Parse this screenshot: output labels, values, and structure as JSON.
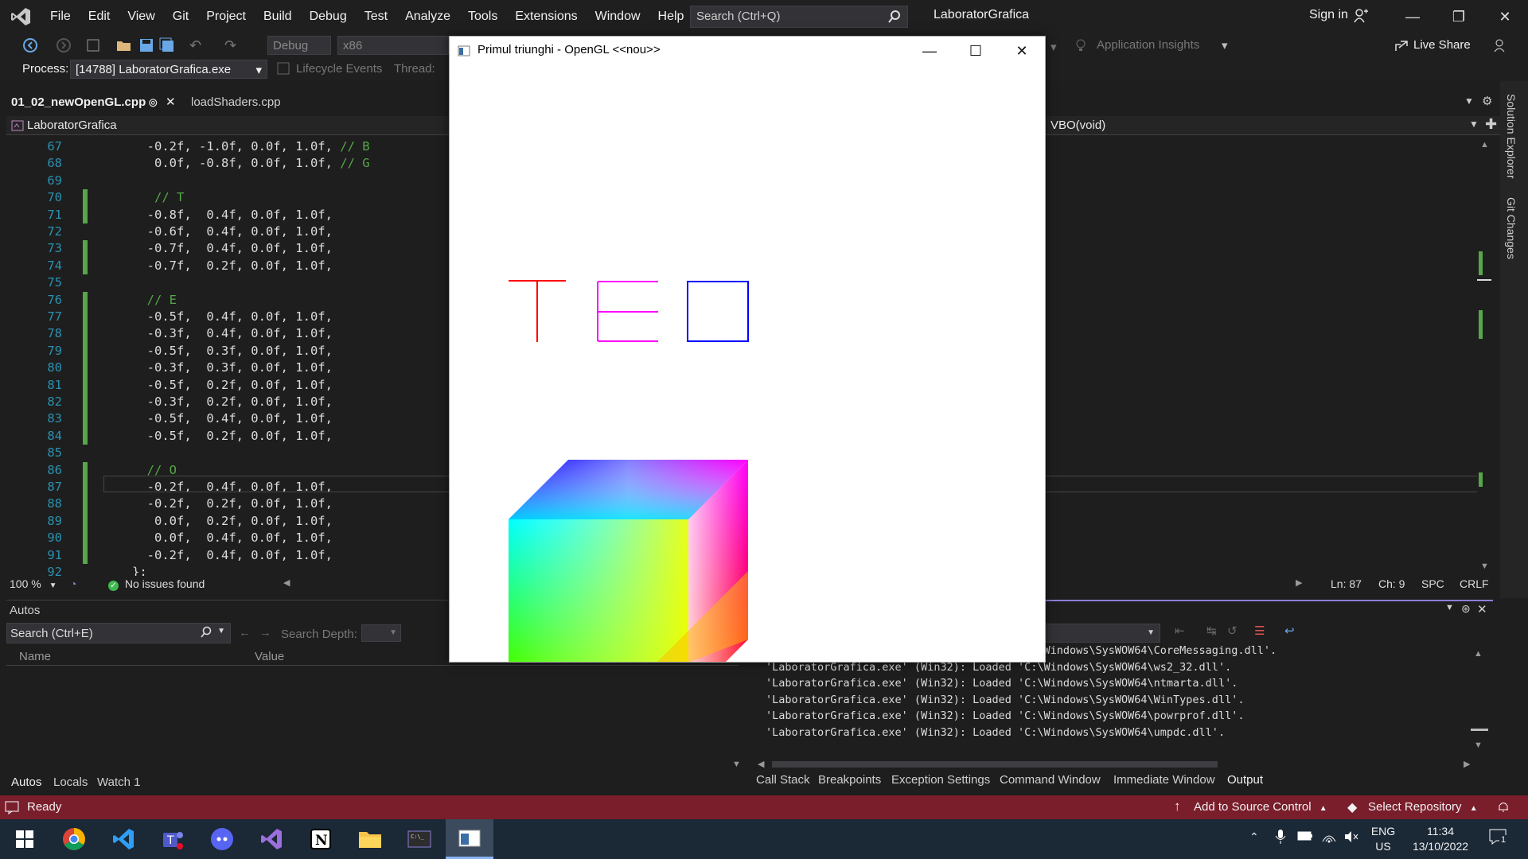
{
  "menubar": {
    "items": [
      "File",
      "Edit",
      "View",
      "Git",
      "Project",
      "Build",
      "Debug",
      "Test",
      "Analyze",
      "Tools",
      "Extensions",
      "Window",
      "Help"
    ],
    "search_placeholder": "Search (Ctrl+Q)",
    "solution_name": "LaboratorGrafica",
    "sign_in": "Sign in"
  },
  "toolbar": {
    "config": "Debug",
    "platform": "x86",
    "app_insights": "Application Insights",
    "live_share": "Live Share",
    "process_label": "Process:",
    "process_value": "[14788] LaboratorGrafica.exe",
    "lifecycle": "Lifecycle Events",
    "thread_label": "Thread:"
  },
  "editor": {
    "tabs": [
      "01_02_newOpenGL.cpp",
      "loadShaders.cpp"
    ],
    "project_nav": "LaboratorGrafica",
    "member_nav": "VBO(void)",
    "lines": [
      {
        "n": "67",
        "code": "  -0.2f, -1.0f, 0.0f, 1.0f, ",
        "comment": "// B",
        "changed": false
      },
      {
        "n": "68",
        "code": "   0.0f, -0.8f, 0.0f, 1.0f, ",
        "comment": "// G",
        "changed": false
      },
      {
        "n": "69",
        "code": "",
        "comment": "",
        "changed": false
      },
      {
        "n": "70",
        "code": "   ",
        "comment": "// T",
        "changed": true
      },
      {
        "n": "71",
        "code": "  -0.8f,  0.4f, 0.0f, 1.0f,",
        "comment": "",
        "changed": true
      },
      {
        "n": "72",
        "code": "  -0.6f,  0.4f, 0.0f, 1.0f,",
        "comment": "",
        "changed": false
      },
      {
        "n": "73",
        "code": "  -0.7f,  0.4f, 0.0f, 1.0f,",
        "comment": "",
        "changed": true
      },
      {
        "n": "74",
        "code": "  -0.7f,  0.2f, 0.0f, 1.0f,",
        "comment": "",
        "changed": true
      },
      {
        "n": "75",
        "code": "",
        "comment": "",
        "changed": false
      },
      {
        "n": "76",
        "code": "  ",
        "comment": "// E",
        "changed": true
      },
      {
        "n": "77",
        "code": "  -0.5f,  0.4f, 0.0f, 1.0f,",
        "comment": "",
        "changed": true
      },
      {
        "n": "78",
        "code": "  -0.3f,  0.4f, 0.0f, 1.0f,",
        "comment": "",
        "changed": true
      },
      {
        "n": "79",
        "code": "  -0.5f,  0.3f, 0.0f, 1.0f,",
        "comment": "",
        "changed": true
      },
      {
        "n": "80",
        "code": "  -0.3f,  0.3f, 0.0f, 1.0f,",
        "comment": "",
        "changed": true
      },
      {
        "n": "81",
        "code": "  -0.5f,  0.2f, 0.0f, 1.0f,",
        "comment": "",
        "changed": true
      },
      {
        "n": "82",
        "code": "  -0.3f,  0.2f, 0.0f, 1.0f,",
        "comment": "",
        "changed": true
      },
      {
        "n": "83",
        "code": "  -0.5f,  0.4f, 0.0f, 1.0f,",
        "comment": "",
        "changed": true
      },
      {
        "n": "84",
        "code": "  -0.5f,  0.2f, 0.0f, 1.0f,",
        "comment": "",
        "changed": true
      },
      {
        "n": "85",
        "code": "",
        "comment": "",
        "changed": false
      },
      {
        "n": "86",
        "code": "  ",
        "comment": "// O",
        "changed": true
      },
      {
        "n": "87",
        "code": "  -0.2f,  0.4f, 0.0f, 1.0f,",
        "comment": "",
        "changed": true
      },
      {
        "n": "88",
        "code": "  -0.2f,  0.2f, 0.0f, 1.0f,",
        "comment": "",
        "changed": true
      },
      {
        "n": "89",
        "code": "   0.0f,  0.2f, 0.0f, 1.0f,",
        "comment": "",
        "changed": true
      },
      {
        "n": "90",
        "code": "   0.0f,  0.4f, 0.0f, 1.0f,",
        "comment": "",
        "changed": true
      },
      {
        "n": "91",
        "code": "  -0.2f,  0.4f, 0.0f, 1.0f,",
        "comment": "",
        "changed": true
      },
      {
        "n": "92",
        "code": "};",
        "comment": "",
        "changed": false
      }
    ],
    "zoom": "100 %",
    "issues": "No issues found",
    "ln": "Ln: 87",
    "ch": "Ch: 9",
    "spc": "SPC",
    "crlf": "CRLF"
  },
  "side_tabs": [
    "Solution Explorer",
    "Git Changes"
  ],
  "autos": {
    "title": "Autos",
    "search_placeholder": "Search (Ctrl+E)",
    "search_depth": "Search Depth:",
    "col_name": "Name",
    "col_value": "Value",
    "tabs": [
      "Autos",
      "Locals",
      "Watch 1"
    ]
  },
  "output": {
    "lines": [
      "'LaboratorGrafica.exe' (Win32): Loaded 'C:\\Windows\\SysWOW64\\CoreMessaging.dll'.",
      "'LaboratorGrafica.exe' (Win32): Loaded 'C:\\Windows\\SysWOW64\\ws2_32.dll'.",
      "'LaboratorGrafica.exe' (Win32): Loaded 'C:\\Windows\\SysWOW64\\ntmarta.dll'.",
      "'LaboratorGrafica.exe' (Win32): Loaded 'C:\\Windows\\SysWOW64\\WinTypes.dll'.",
      "'LaboratorGrafica.exe' (Win32): Loaded 'C:\\Windows\\SysWOW64\\powrprof.dll'.",
      "'LaboratorGrafica.exe' (Win32): Loaded 'C:\\Windows\\SysWOW64\\umpdc.dll'."
    ],
    "tabs": [
      "Call Stack",
      "Breakpoints",
      "Exception Settings",
      "Command Window",
      "Immediate Window",
      "Output"
    ]
  },
  "statusbar": {
    "ready": "Ready",
    "source_control": "Add to Source Control",
    "repository": "Select Repository"
  },
  "taskbar": {
    "lang1": "ENG",
    "lang2": "US",
    "time": "11:34",
    "date": "13/10/2022",
    "notifications": "1"
  },
  "gl_window": {
    "title": "Primul triunghi - OpenGL <<nou>>",
    "colors": {
      "T": "#ff0000",
      "E": "#ff00ff",
      "O": "#0000ff"
    }
  }
}
